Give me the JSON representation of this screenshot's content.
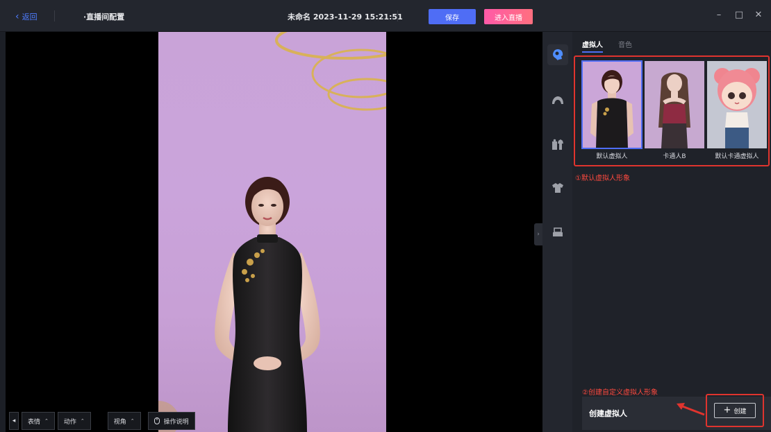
{
  "titlebar": {
    "back_label": "返回",
    "crumb": "·直播间配置",
    "document_title": "未命名 2023-11-29 15:21:51",
    "save_label": "保存",
    "live_label": "进入直播",
    "minimize_glyph": "–",
    "maximize_glyph": "□",
    "close_glyph": "✕"
  },
  "viewport_toolbar": {
    "expression_label": "表情",
    "action_label": "动作",
    "view_label": "视角",
    "help_label": "操作说明",
    "caret_glyph": "⌃",
    "prev_glyph": "◂"
  },
  "rail": {
    "items": [
      {
        "icon": "avatar-head-icon",
        "active": true
      },
      {
        "icon": "hair-icon",
        "active": false
      },
      {
        "icon": "outfit-set-icon",
        "active": false
      },
      {
        "icon": "shirt-icon",
        "active": false
      },
      {
        "icon": "background-icon",
        "active": false
      }
    ]
  },
  "panel": {
    "tabs": [
      "虚拟人",
      "音色"
    ],
    "active_tab": "虚拟人",
    "avatars": [
      {
        "name": "默认虚拟人",
        "selected": true
      },
      {
        "name": "卡通人B",
        "selected": false
      },
      {
        "name": "默认卡通虚拟人",
        "selected": false
      }
    ],
    "note_default": "①默认虚拟人形象",
    "note_create": "②创建自定义虚拟人形象",
    "create_title": "创建虚拟人",
    "create_button": "创建",
    "create_plus": "+"
  },
  "colors": {
    "accent": "#4f6df5",
    "live_gradient_start": "#ff5aa8",
    "annotation_red": "#e0342e",
    "stage_background": "#c9a3d8"
  }
}
